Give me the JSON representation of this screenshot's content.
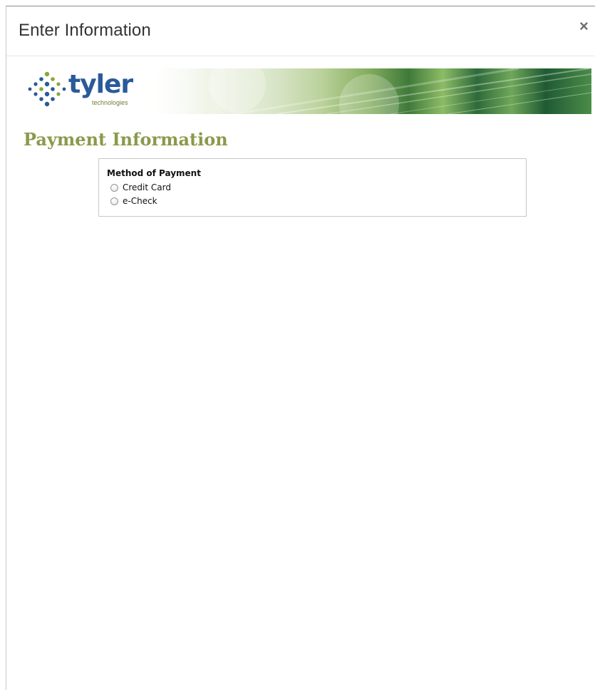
{
  "dialog": {
    "title": "Enter Information",
    "close_label": "×"
  },
  "banner": {
    "logo_word": "tyler",
    "logo_sub": "technologies",
    "logo_colors": {
      "dots_blue": "#2a5a9a",
      "dots_green": "#8aa63c"
    }
  },
  "page": {
    "heading": "Payment Information",
    "heading_color": "#8a9a4a"
  },
  "payment": {
    "label": "Method of Payment",
    "options": [
      {
        "label": "Credit Card",
        "selected": false
      },
      {
        "label": "e-Check",
        "selected": false
      }
    ]
  }
}
